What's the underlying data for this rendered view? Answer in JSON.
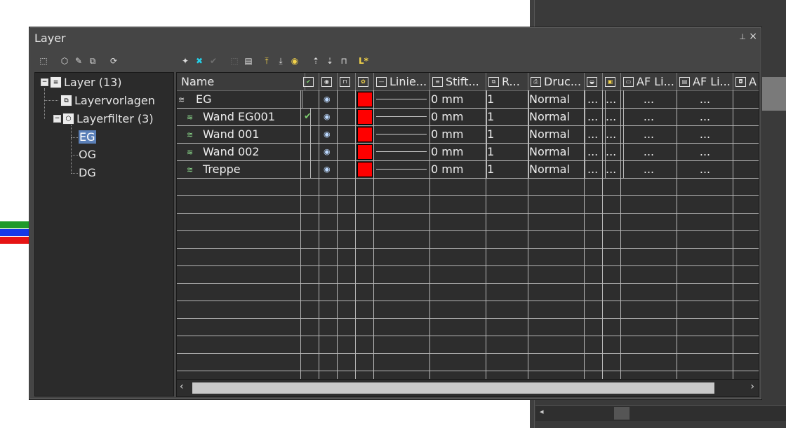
{
  "window": {
    "title": "Layer"
  },
  "icons": {
    "pin": "pin-icon",
    "close": "close-icon"
  },
  "tree": {
    "root": {
      "label": "Layer (13)"
    },
    "templates": {
      "label": "Layervorlagen"
    },
    "filters": {
      "label": "Layerfilter (3)"
    },
    "children": [
      {
        "label": "EG",
        "selected": true
      },
      {
        "label": "OG",
        "selected": false
      },
      {
        "label": "DG",
        "selected": false
      }
    ]
  },
  "grid": {
    "columns": [
      {
        "label": "Name"
      },
      {
        "label": ""
      },
      {
        "label": ""
      },
      {
        "label": ""
      },
      {
        "label": ""
      },
      {
        "label": "Linie..."
      },
      {
        "label": "Stift..."
      },
      {
        "label": "R..."
      },
      {
        "label": "Druc..."
      },
      {
        "label": ""
      },
      {
        "label": ""
      },
      {
        "label": "AF Li..."
      },
      {
        "label": "AF Li..."
      },
      {
        "label": "A"
      }
    ],
    "rows": [
      {
        "name": "EG",
        "checked": false,
        "pen": "0 mm",
        "r": "1",
        "print": "Normal",
        "c9": "...",
        "c10": "...",
        "c11": "...",
        "c12": "...",
        "group": true
      },
      {
        "name": "Wand EG001",
        "checked": true,
        "pen": "0 mm",
        "r": "1",
        "print": "Normal",
        "c9": "...",
        "c10": "...",
        "c11": "...",
        "c12": "...",
        "group": false
      },
      {
        "name": "Wand 001",
        "checked": false,
        "pen": "0 mm",
        "r": "1",
        "print": "Normal",
        "c9": "...",
        "c10": "...",
        "c11": "...",
        "c12": "...",
        "group": false
      },
      {
        "name": "Wand 002",
        "checked": false,
        "pen": "0 mm",
        "r": "1",
        "print": "Normal",
        "c9": "...",
        "c10": "...",
        "c11": "...",
        "c12": "...",
        "group": false
      },
      {
        "name": "Treppe",
        "checked": false,
        "pen": "0 mm",
        "r": "1",
        "print": "Normal",
        "c9": "...",
        "c10": "...",
        "c11": "...",
        "c12": "...",
        "group": false
      }
    ]
  },
  "colors": {
    "layer_color": "#ff0000",
    "selection": "#5b80b8",
    "panel_bg": "#454545"
  }
}
